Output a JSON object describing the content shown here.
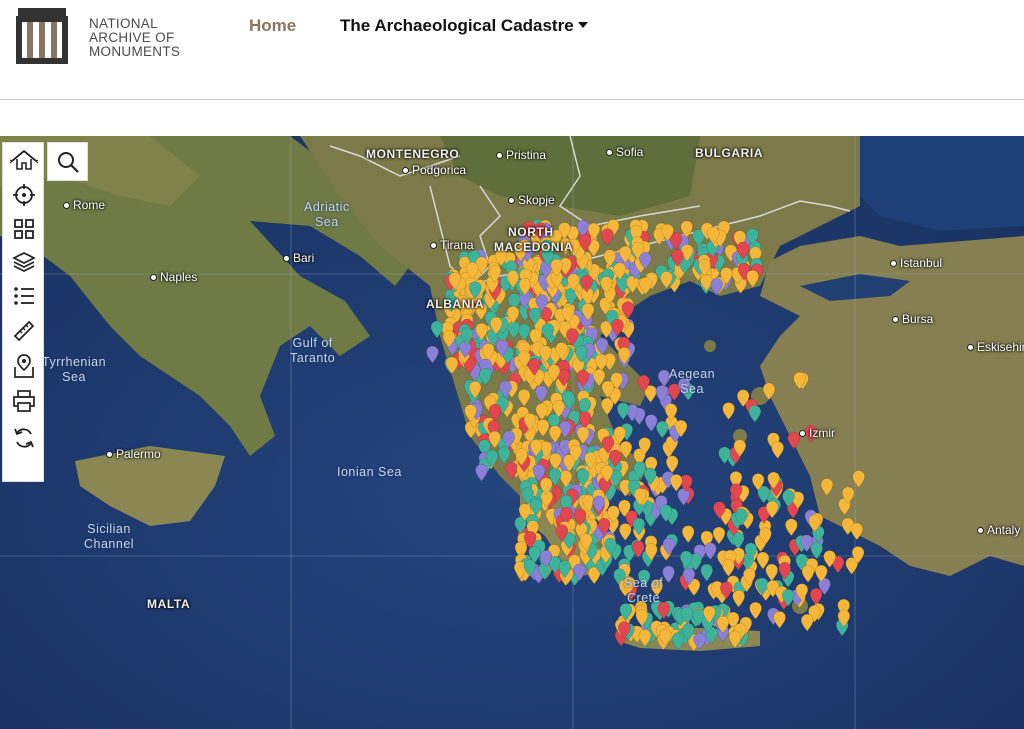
{
  "header": {
    "logo_lines": [
      "NATIONAL",
      "ARCHIVE OF",
      "MONUMENTS"
    ],
    "nav_home": "Home",
    "nav_cadastre": "The Archaeological Cadastre"
  },
  "map": {
    "cities": [
      {
        "id": "rome",
        "label": "Rome"
      },
      {
        "id": "naples",
        "label": "Naples"
      },
      {
        "id": "bari",
        "label": "Bari"
      },
      {
        "id": "palermo",
        "label": "Palermo"
      },
      {
        "id": "podgorica",
        "label": "Podgorica"
      },
      {
        "id": "pristina",
        "label": "Pristina"
      },
      {
        "id": "sofia",
        "label": "Sofia"
      },
      {
        "id": "skopje",
        "label": "Skopje"
      },
      {
        "id": "tirana",
        "label": "Tirana"
      },
      {
        "id": "istanbul",
        "label": "Istanbul"
      },
      {
        "id": "bursa",
        "label": "Bursa"
      },
      {
        "id": "eskisehir",
        "label": "Eskisehir"
      },
      {
        "id": "izmir",
        "label": "Izmir"
      },
      {
        "id": "antalya",
        "label": "Antaly"
      }
    ],
    "countries": {
      "montenegro": "MONTENEGRO",
      "bulgaria": "BULGARIA",
      "north_macedonia_1": "NORTH",
      "north_macedonia_2": "MACEDONIA",
      "albania": "ALBANIA",
      "malta": "MALTA"
    },
    "seas": {
      "adriatic_1": "Adriatic",
      "adriatic_2": "Sea",
      "taranto_1": "Gulf of",
      "taranto_2": "Taranto",
      "tyrrhenian_1": "Tyrrhenian",
      "tyrrhenian_2": "Sea",
      "ionian": "Ionian Sea",
      "aegean_1": "Aegean",
      "aegean_2": "Sea",
      "sicilian_1": "Sicilian",
      "sicilian_2": "Channel",
      "crete_1": "Sea of",
      "crete_2": "Crete"
    },
    "marker_colors": {
      "yellow": "#f4b73a",
      "teal": "#3fb39a",
      "purple": "#8b7fd6",
      "red": "#e2474f"
    }
  },
  "tools": [
    "home-icon",
    "locate-icon",
    "grid-icon",
    "layers-icon",
    "list-icon",
    "ruler-icon",
    "map-pin-icon",
    "print-icon",
    "refresh-icon",
    "search-icon"
  ]
}
